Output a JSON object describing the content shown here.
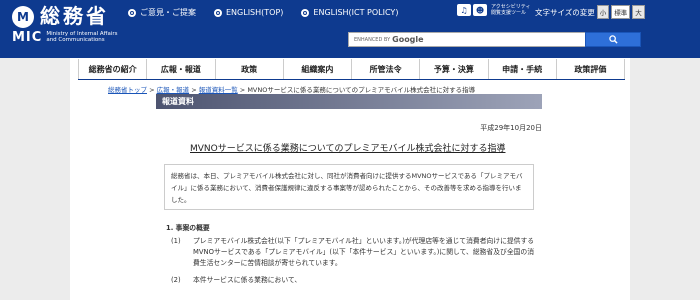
{
  "header": {
    "logo_mark": "M",
    "site_name": "総務省",
    "logo_abbr": "MIC",
    "logo_en": "Ministry of Internal Affairs and Communications",
    "top_links": [
      {
        "label": "ご意見・ご提案"
      },
      {
        "label": "ENGLISH(TOP)"
      },
      {
        "label": "ENGLISH(ICT POLICY)"
      }
    ],
    "accessibility_tool": "アクセシビリティ閲覧支援ツール",
    "font_size_label": "文字サイズの変更",
    "font_sizes": [
      "小",
      "標準",
      "大"
    ],
    "search": {
      "enhanced": "ENHANCED BY",
      "brand": "Google"
    }
  },
  "nav": {
    "items": [
      "総務省の紹介",
      "広報・報道",
      "政策",
      "組織案内",
      "所管法令",
      "予算・決算",
      "申請・手続",
      "政策評価"
    ]
  },
  "breadcrumb": {
    "items": [
      "総務省トップ",
      "広報・報道",
      "報道資料一覧"
    ],
    "separator": ">",
    "current": "MVNOサービスに係る業務についてのプレミアモバイル株式会社に対する指導"
  },
  "section_title": "報道資料",
  "date": "平成29年10月20日",
  "article": {
    "title": "MVNOサービスに係る業務についてのプレミアモバイル株式会社に対する指導",
    "abstract": "総務省は、本日、プレミアモバイル株式会社に対し、同社が消費者向けに提供するMVNOサービスである「プレミアモバイル」に係る業務において、消費者保護規律に違反する事案等が認められたことから、その改善等を求める指導を行いました。",
    "section1": "1. 事案の概要",
    "items": [
      {
        "num": "(1)",
        "text": "プレミアモバイル株式会社(以下「プレミアモバイル社」といいます。)が代理店等を通じて消費者向けに提供するMVNOサービスである「プレミアモバイル」(以下「本件サービス」といいます。)に関して、総務省及び全国の消費生活センターに苦情相談が寄せられています。"
      },
      {
        "num": "(2)",
        "text": "本件サービスに係る業務において、"
      }
    ]
  }
}
